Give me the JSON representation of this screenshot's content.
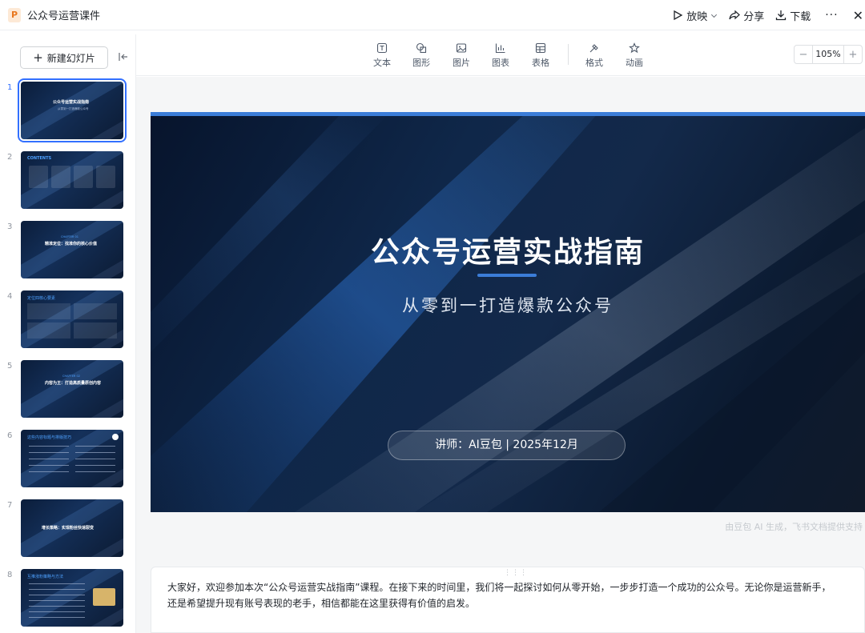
{
  "app": {
    "logo_letter": "P",
    "title": "公众号运营课件"
  },
  "top_actions": {
    "play": "放映",
    "share": "分享",
    "download": "下载",
    "more": "···",
    "close": "✕"
  },
  "sidebar": {
    "new_slide": "新建幻灯片",
    "thumbnails": [
      {
        "num": "1",
        "title": "公众号运营实战指南",
        "sub": "从零到一打造爆款公众号"
      },
      {
        "num": "2",
        "title": "CONTENTS",
        "sub": ""
      },
      {
        "num": "3",
        "title": "精准定位：找准你的核心价值",
        "sub": "CHAPTER 01"
      },
      {
        "num": "4",
        "title": "定位四核心要素",
        "sub": ""
      },
      {
        "num": "5",
        "title": "内容为王：打造高质量原创内容",
        "sub": "CHAPTER 02"
      },
      {
        "num": "6",
        "title": "这些内容标题与排版技巧",
        "sub": ""
      },
      {
        "num": "7",
        "title": "增长策略：实现粉丝快速裂变",
        "sub": ""
      },
      {
        "num": "8",
        "title": "互推涨粉策略与方法",
        "sub": ""
      }
    ]
  },
  "toolbar": {
    "text": "文本",
    "shape": "图形",
    "image": "图片",
    "chart": "图表",
    "table": "表格",
    "format": "格式",
    "animation": "动画",
    "zoom_minus": "−",
    "zoom_value": "105%",
    "zoom_plus": "+"
  },
  "slide": {
    "title": "公众号运营实战指南",
    "subtitle": "从零到一打造爆款公众号",
    "speaker": "讲师：AI豆包 | 2025年12月"
  },
  "watermark": "由豆包 AI 生成，飞书文档提供支持",
  "notes": {
    "handle": "⋮⋮⋮",
    "text": "大家好，欢迎参加本次“公众号运营实战指南”课程。在接下来的时间里，我们将一起探讨如何从零开始，一步步打造一个成功的公众号。无论你是运营新手，还是希望提升现有账号表现的老手，相信都能在这里获得有价值的启发。"
  },
  "colors": {
    "accent": "#3370ff",
    "slide_accent": "#3b7dd8",
    "slide_bg": "#0f2749"
  }
}
